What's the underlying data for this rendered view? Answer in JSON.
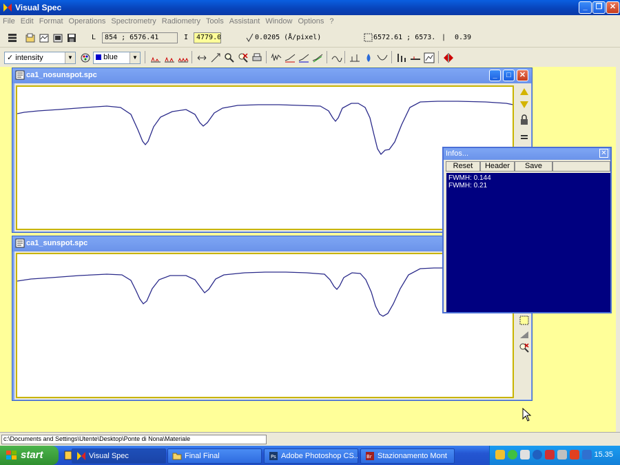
{
  "window": {
    "title": "Visual Spec"
  },
  "menu": [
    "File",
    "Edit",
    "Format",
    "Operations",
    "Spectrometry",
    "Radiometry",
    "Tools",
    "Assistant",
    "Window",
    "Options",
    "?"
  ],
  "toolbar1": {
    "l_label": "L",
    "l_value": "854 ; 6576.41",
    "i_label": "I",
    "i_value": "4779.0",
    "dispersion": "0.0205 (Å/pixel)",
    "selection": "6572.61 ; 6573.",
    "sel_sep": "|",
    "sel_value": "0.39"
  },
  "toolbar2": {
    "quantity_select": "intensity",
    "color_select": "blue",
    "color_swatch": "#0000cc"
  },
  "windows": [
    {
      "title": "ca1_nosunspot.spc",
      "line_color": "#2a2a8a",
      "profile": [
        [
          0,
          39
        ],
        [
          10,
          37
        ],
        [
          30,
          35
        ],
        [
          60,
          33
        ],
        [
          100,
          30
        ],
        [
          130,
          28
        ],
        [
          150,
          30
        ],
        [
          165,
          40
        ],
        [
          175,
          62
        ],
        [
          182,
          79
        ],
        [
          186,
          84
        ],
        [
          190,
          79
        ],
        [
          198,
          58
        ],
        [
          208,
          44
        ],
        [
          225,
          36
        ],
        [
          245,
          33
        ],
        [
          258,
          40
        ],
        [
          265,
          52
        ],
        [
          270,
          57
        ],
        [
          276,
          52
        ],
        [
          286,
          38
        ],
        [
          298,
          31
        ],
        [
          320,
          27
        ],
        [
          350,
          26
        ],
        [
          380,
          26
        ],
        [
          410,
          27
        ],
        [
          440,
          28
        ],
        [
          452,
          35
        ],
        [
          458,
          45
        ],
        [
          462,
          50
        ],
        [
          466,
          45
        ],
        [
          472,
          31
        ],
        [
          485,
          24
        ],
        [
          495,
          24
        ],
        [
          505,
          30
        ],
        [
          512,
          45
        ],
        [
          518,
          70
        ],
        [
          523,
          90
        ],
        [
          528,
          98
        ],
        [
          534,
          92
        ],
        [
          540,
          91
        ],
        [
          548,
          80
        ],
        [
          558,
          55
        ],
        [
          570,
          30
        ],
        [
          585,
          22
        ],
        [
          610,
          21
        ],
        [
          640,
          21
        ],
        [
          680,
          22
        ],
        [
          710,
          24
        ],
        [
          720,
          26
        ]
      ]
    },
    {
      "title": "ca1_sunspot.spc",
      "line_color": "#2a2a8a",
      "profile": [
        [
          0,
          39
        ],
        [
          20,
          36
        ],
        [
          50,
          34
        ],
        [
          90,
          31
        ],
        [
          130,
          29
        ],
        [
          152,
          30
        ],
        [
          165,
          38
        ],
        [
          172,
          52
        ],
        [
          178,
          65
        ],
        [
          183,
          72
        ],
        [
          188,
          68
        ],
        [
          196,
          50
        ],
        [
          206,
          37
        ],
        [
          222,
          31
        ],
        [
          245,
          31
        ],
        [
          258,
          37
        ],
        [
          266,
          48
        ],
        [
          272,
          56
        ],
        [
          278,
          51
        ],
        [
          288,
          36
        ],
        [
          300,
          30
        ],
        [
          330,
          27
        ],
        [
          360,
          26
        ],
        [
          390,
          26
        ],
        [
          420,
          27
        ],
        [
          446,
          29
        ],
        [
          454,
          37
        ],
        [
          460,
          47
        ],
        [
          464,
          51
        ],
        [
          468,
          46
        ],
        [
          474,
          34
        ],
        [
          486,
          27
        ],
        [
          498,
          28
        ],
        [
          506,
          37
        ],
        [
          514,
          55
        ],
        [
          520,
          75
        ],
        [
          526,
          87
        ],
        [
          531,
          90
        ],
        [
          538,
          86
        ],
        [
          546,
          72
        ],
        [
          556,
          50
        ],
        [
          568,
          30
        ],
        [
          585,
          21
        ],
        [
          605,
          20
        ],
        [
          617,
          20
        ]
      ]
    }
  ],
  "infos": {
    "title": "Infos...",
    "buttons": [
      "Reset",
      "Header",
      "Save"
    ],
    "lines": [
      "FWMH: 0.144",
      "FWMH: 0.21"
    ]
  },
  "status": {
    "path": "c:\\Documents and Settings\\Utente\\Desktop\\Ponte di Nona\\Materiale"
  },
  "taskbar": {
    "start": "start",
    "tasks": [
      "Visual Spec",
      "Final Final",
      "Adobe Photoshop CS...",
      "Stazionamento Mont"
    ],
    "clock": "15.35"
  }
}
